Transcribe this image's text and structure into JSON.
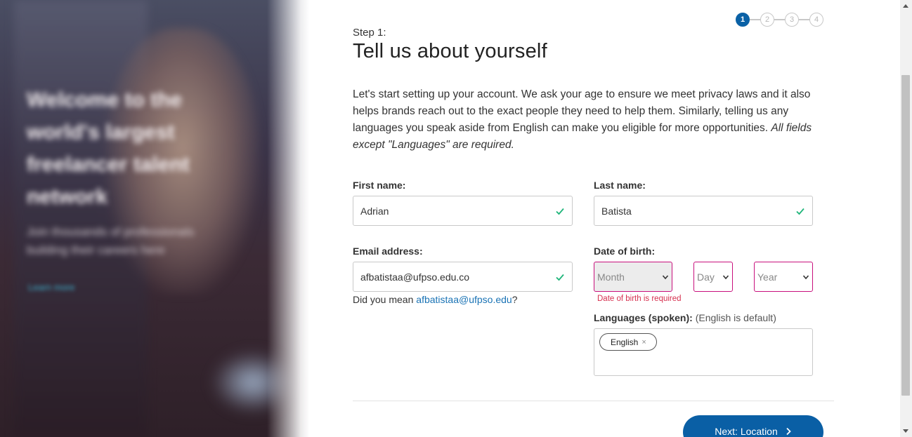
{
  "hero": {
    "title": "Welcome to the world's largest freelancer talent network",
    "subtitle": "Join thousands of professionals building their careers here",
    "link": "Learn more"
  },
  "stepper": {
    "steps": [
      "1",
      "2",
      "3",
      "4"
    ],
    "active": 1
  },
  "step": {
    "label": "Step 1:",
    "title": "Tell us about yourself",
    "intro": "Let's start setting up your account. We ask your age to ensure we meet privacy laws and it also helps brands reach out to the exact people they need to help them. Similarly, telling us any languages you speak aside from English can make you eligible for more opportunities.",
    "intro_emphasis": "All fields except \"Languages\" are required."
  },
  "form": {
    "first_name": {
      "label": "First name:",
      "value": "Adrian"
    },
    "last_name": {
      "label": "Last name:",
      "value": "Batista"
    },
    "email": {
      "label": "Email address:",
      "value": "afbatistaa@ufpso.edu.co",
      "suggest_prefix": "Did you mean ",
      "suggest_link": "afbatistaa@ufpso.edu",
      "suggest_suffix": "?"
    },
    "dob": {
      "label": "Date of birth:",
      "month_placeholder": "Month",
      "day_placeholder": "Day",
      "year_placeholder": "Year",
      "error": "Date of birth is required"
    },
    "languages": {
      "label": "Languages (spoken):",
      "hint": "(English is default)",
      "chips": [
        {
          "label": "English",
          "remove": "×"
        }
      ]
    }
  },
  "actions": {
    "next_label": "Next: Location"
  },
  "colors": {
    "primary": "#0a5fa5",
    "valid": "#1fb57a",
    "error": "#d6304f",
    "invalid_border": "#c8107d",
    "link": "#1a73b5"
  }
}
